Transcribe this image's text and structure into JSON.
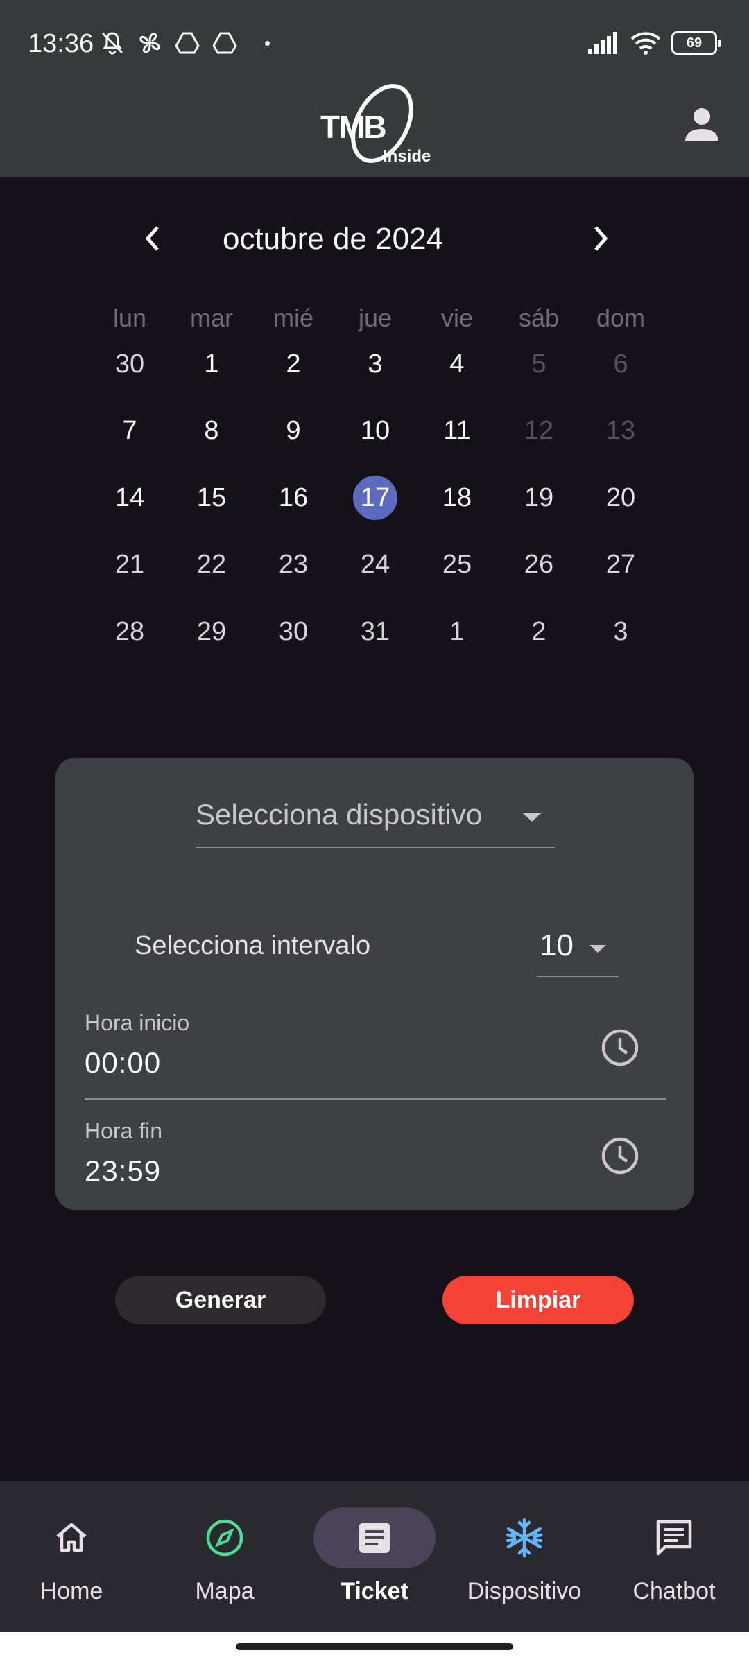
{
  "status_bar": {
    "time": "13:36",
    "battery": "69"
  },
  "app_bar": {
    "logo_main": "TMB",
    "logo_sub": "Inside",
    "profile_icon": "person-icon"
  },
  "calendar": {
    "month_title": "octubre de 2024",
    "weekdays": [
      "lun",
      "mar",
      "mié",
      "jue",
      "vie",
      "sáb",
      "dom"
    ],
    "weeks": [
      [
        "30",
        "1",
        "2",
        "3",
        "4",
        "5",
        "6"
      ],
      [
        "7",
        "8",
        "9",
        "10",
        "11",
        "12",
        "13"
      ],
      [
        "14",
        "15",
        "16",
        "17",
        "18",
        "19",
        "20"
      ],
      [
        "21",
        "22",
        "23",
        "24",
        "25",
        "26",
        "27"
      ],
      [
        "28",
        "29",
        "30",
        "31",
        "1",
        "2",
        "3"
      ]
    ],
    "selected_day": "17"
  },
  "form": {
    "device_placeholder": "Selecciona dispositivo",
    "interval_label": "Selecciona intervalo",
    "interval_value": "10",
    "start_label": "Hora inicio",
    "start_value": "00:00",
    "end_label": "Hora fin",
    "end_value": "23:59"
  },
  "buttons": {
    "generate": "Generar",
    "clear": "Limpiar"
  },
  "bottom_nav": [
    {
      "label": "Home",
      "icon": "home-icon"
    },
    {
      "label": "Mapa",
      "icon": "compass-icon"
    },
    {
      "label": "Ticket",
      "icon": "ticket-icon"
    },
    {
      "label": "Dispositivo",
      "icon": "snowflake-icon"
    },
    {
      "label": "Chatbot",
      "icon": "chat-icon"
    }
  ],
  "colors": {
    "accent_selected": "#5c6bc0",
    "clear_button": "#f44336",
    "compass_green": "#4ade94",
    "snowflake_blue": "#64b5f6"
  }
}
